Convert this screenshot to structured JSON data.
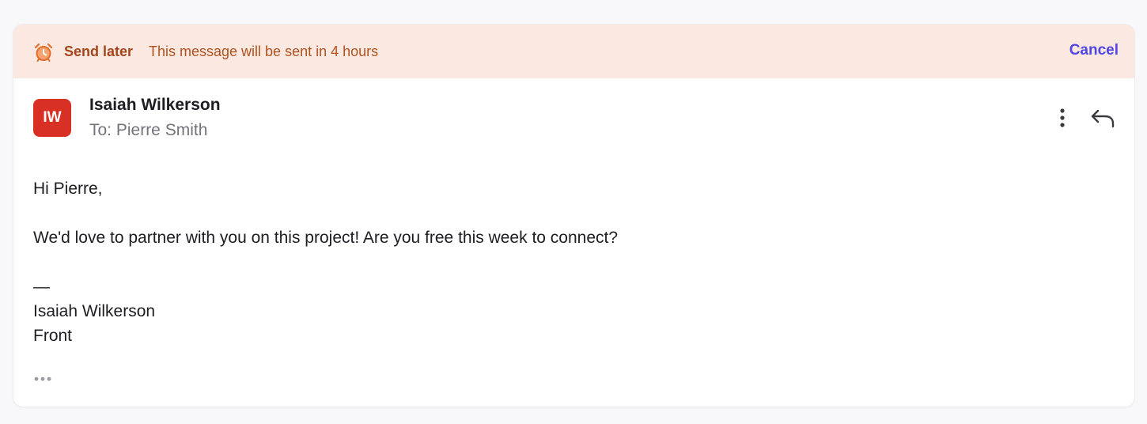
{
  "banner": {
    "icon": "alarm-clock-icon",
    "title": "Send later",
    "message": "This message will be sent in 4 hours",
    "cancel_label": "Cancel",
    "accent_color": "#a4451c",
    "background_color": "#fbe8e0"
  },
  "email": {
    "avatar_initials": "IW",
    "avatar_color": "#d93025",
    "sender_name": "Isaiah Wilkerson",
    "recipient": "To: Pierre Smith",
    "actions": [
      "more-vertical-icon",
      "reply-icon"
    ],
    "body": {
      "greeting": "Hi Pierre,",
      "paragraph": "We'd love to partner with you on this project! Are you free this week to connect?",
      "signature_separator": "—",
      "signature_name": "Isaiah Wilkerson",
      "signature_company": "Front"
    },
    "expand_icon": "ellipsis-icon"
  },
  "colors": {
    "link": "#4f46e5"
  }
}
